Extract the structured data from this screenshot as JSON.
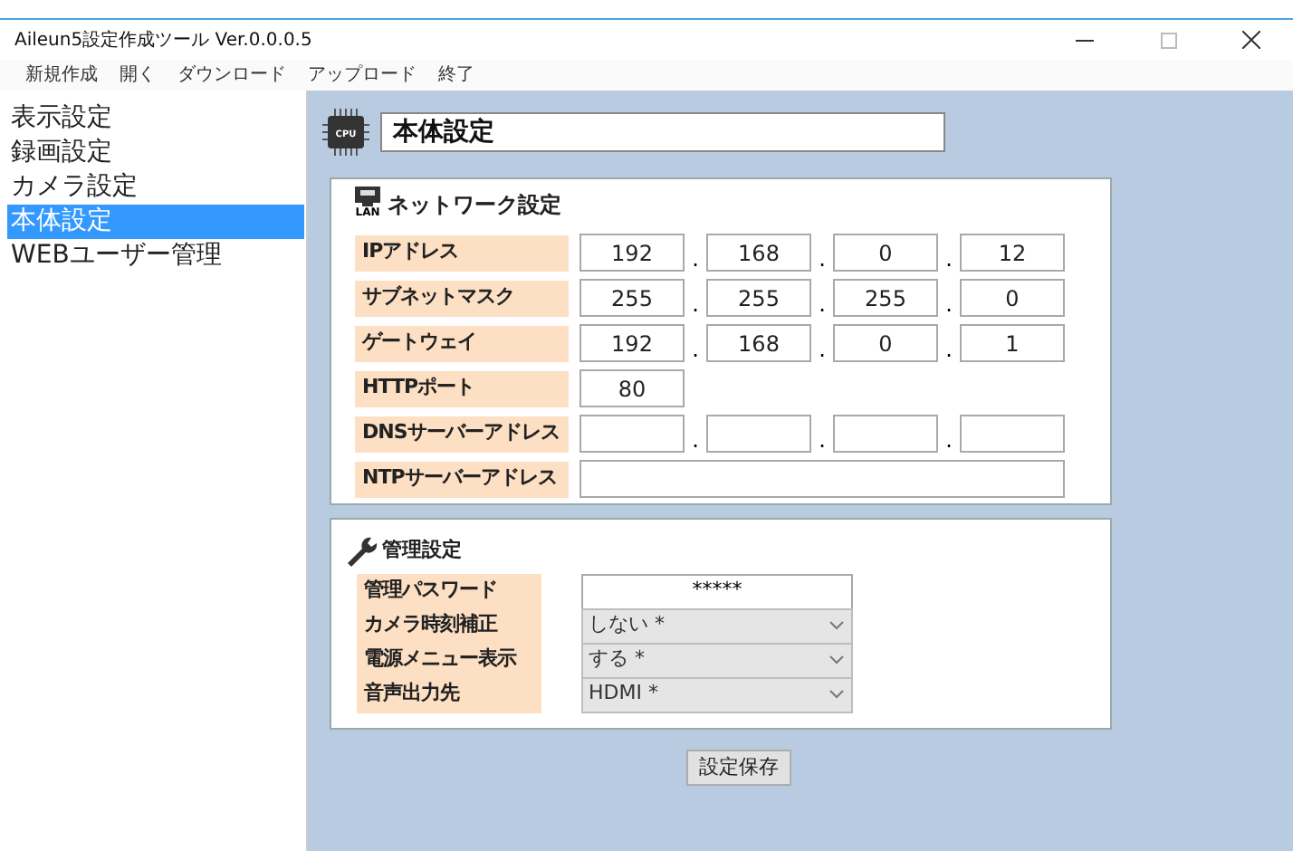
{
  "window": {
    "title": "Aileun5設定作成ツール Ver.0.0.0.5"
  },
  "menu": [
    "新規作成",
    "開く",
    "ダウンロード",
    "アップロード",
    "終了"
  ],
  "sidebar": {
    "items": [
      {
        "label": "表示設定",
        "selected": false
      },
      {
        "label": "録画設定",
        "selected": false
      },
      {
        "label": "カメラ設定",
        "selected": false
      },
      {
        "label": "本体設定",
        "selected": true
      },
      {
        "label": "WEBユーザー管理",
        "selected": false
      }
    ]
  },
  "header": {
    "chip_label": "CPU",
    "value": "本体設定"
  },
  "network": {
    "title": "ネットワーク設定",
    "icon_label": "LAN",
    "rows": [
      {
        "label": "IPアドレス",
        "kind": "ip",
        "octets": [
          "192",
          "168",
          "0",
          "12"
        ],
        "separator": "."
      },
      {
        "label": "サブネットマスク",
        "kind": "ip",
        "octets": [
          "255",
          "255",
          "255",
          "0"
        ],
        "separator": "."
      },
      {
        "label": "ゲートウェイ",
        "kind": "ip",
        "octets": [
          "192",
          "168",
          "0",
          "1"
        ],
        "separator": "."
      },
      {
        "label": "HTTPポート",
        "kind": "single",
        "value": "80"
      },
      {
        "label": "DNSサーバーアドレス",
        "kind": "ip_blank",
        "separator": "."
      },
      {
        "label": "NTPサーバーアドレス",
        "kind": "wide_blank"
      }
    ]
  },
  "admin": {
    "title": "管理設定",
    "rows": [
      {
        "label": "管理パスワード",
        "kind": "password",
        "value": "*****"
      },
      {
        "label": "カメラ時刻補正",
        "kind": "select",
        "value": "しない *"
      },
      {
        "label": "電源メニュー表示",
        "kind": "select",
        "value": "する *"
      },
      {
        "label": "音声出力先",
        "kind": "select",
        "value": "HDMI *"
      }
    ]
  },
  "save_button": "設定保存"
}
